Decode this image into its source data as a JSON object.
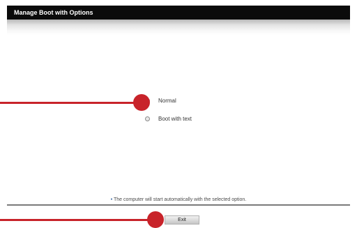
{
  "window": {
    "title": "Manage Boot with Options"
  },
  "options": [
    {
      "label": "Normal",
      "selected": true
    },
    {
      "label": "Boot with text",
      "selected": false
    }
  ],
  "footer": {
    "note": "The computer will start automatically with the selected option."
  },
  "exit_button": {
    "label": "Exit"
  },
  "annotations": {
    "color": "#c8232a"
  }
}
